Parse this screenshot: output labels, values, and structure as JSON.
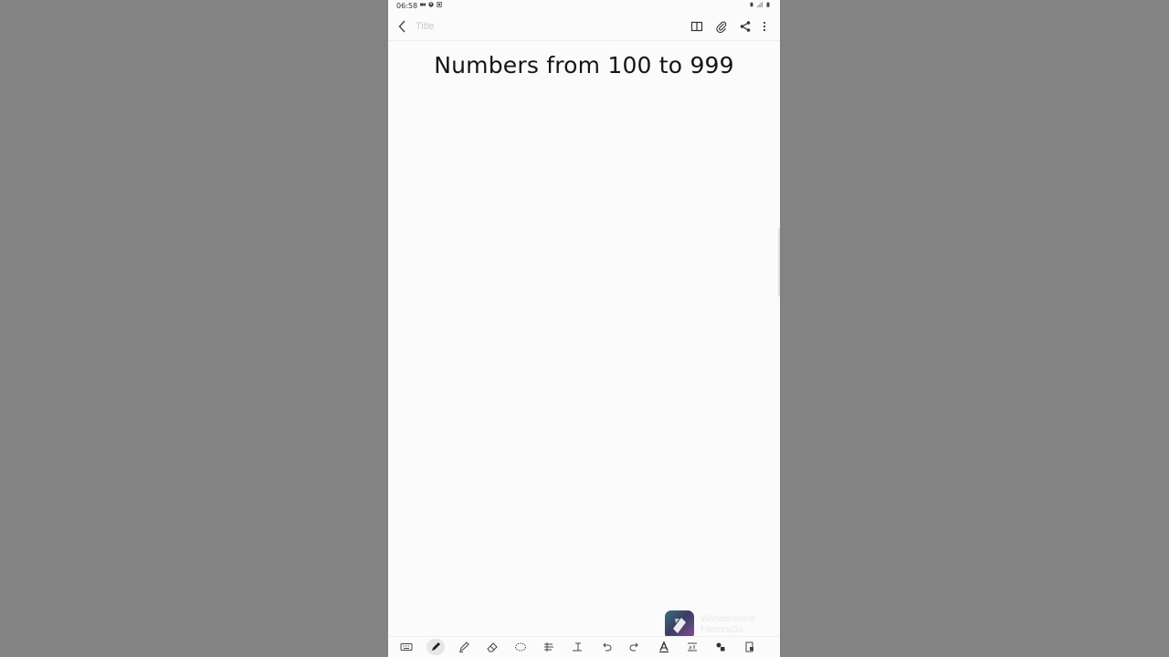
{
  "status_bar": {
    "time": "06:58"
  },
  "note": {
    "title_placeholder": "Title",
    "content_text": "Numbers from 100 to 999"
  },
  "toolbar": {
    "active_tool": "pen",
    "tools": [
      "keyboard",
      "pen",
      "highlighter",
      "eraser",
      "lasso",
      "text-style",
      "text-size",
      "undo",
      "redo",
      "handwriting-to-text",
      "format-fit",
      "shapes",
      "lock"
    ]
  },
  "watermark": {
    "line1": "Wondershare",
    "line2": "FilmoraGo"
  },
  "colors": {
    "page_bg": "#fbfbfb",
    "backdrop": "#838383"
  }
}
